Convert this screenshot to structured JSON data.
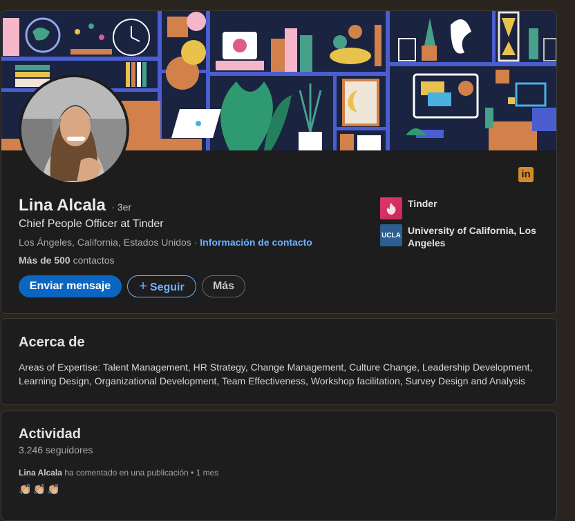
{
  "profile": {
    "name": "Lina Alcala",
    "degree": "· 3er",
    "headline": "Chief People Officer at Tinder",
    "location": "Los Ángeles, California, Estados Unidos",
    "location_separator": " · ",
    "contact_link": "Información de contacto",
    "connections_bold": "Más de 500",
    "connections_rest": " contactos",
    "linkedin_icon_label": "in"
  },
  "actions": {
    "message": "Enviar mensaje",
    "follow_plus": "+",
    "follow": "Seguir",
    "more": "Más"
  },
  "orgs": [
    {
      "name": "Tinder",
      "icon": "tinder-flame-icon"
    },
    {
      "name": "University of California, Los Angeles",
      "logo_text": "UCLA"
    }
  ],
  "about": {
    "title": "Acerca de",
    "text": "Areas of Expertise: Talent Management, HR Strategy, Change Management, Culture Change, Leadership Development, Learning Design, Organizational Development, Team Effectiveness, Workshop facilitation, Survey Design and Analysis"
  },
  "activity": {
    "title": "Actividad",
    "followers": "3.246 seguidores",
    "author": "Lina Alcala",
    "action": " ha comentado en una publicación • 1 mes",
    "emojis": "👏🏼👏🏼👏🏼"
  },
  "colors": {
    "background": "#2a241f",
    "card": "#1d1d1e",
    "primary_button": "#0b66c2",
    "link": "#6fb2ff",
    "banner_navy": "#1a2340",
    "banner_blue": "#4a5ed0",
    "banner_orange": "#d3814a"
  }
}
